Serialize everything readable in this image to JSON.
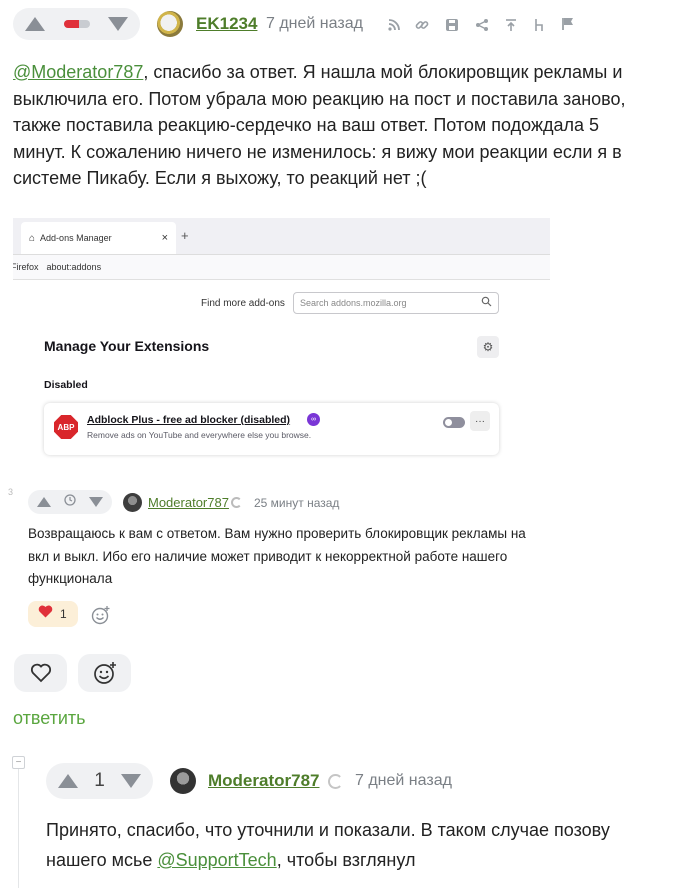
{
  "top_comment": {
    "author": "EK1234",
    "time": "7 дней назад",
    "icons": [
      "rss-icon",
      "link-icon",
      "save-icon",
      "share-icon",
      "branch-up-icon",
      "branch-icon",
      "flag-icon"
    ],
    "body_mention": "@Moderator787",
    "body_lines": [
      ", спасибо за ответ. Я нашла мой блокировщик рекламы и",
      "выключила его. Потом убрала мою реакцию на пост и поставила заново,",
      "также поставила реакцию-сердечко на ваш ответ. Потом подождала 5",
      "минут. К сожалению ничего не изменилось: я вижу мои реакции если я в",
      "системе Пикабу. Если я выхожу, то реакций нет ;("
    ],
    "screenshot": {
      "tab_title": "Add-ons Manager",
      "tab_close": "×",
      "new_tab": "+",
      "browser": "Firefox",
      "url": "about:addons",
      "find_label": "Find more add-ons",
      "search_placeholder": "Search addons.mozilla.org",
      "heading": "Manage Your Extensions",
      "section": "Disabled",
      "ext_icon_text": "ABP",
      "ext_name": "Adblock Plus - free ad blocker (disabled)",
      "ext_desc": "Remove ads on YouTube and everywhere else you browse.",
      "more": "···"
    },
    "quoted": {
      "author": "Moderator787",
      "time": "25 минут назад",
      "lines": [
        "Возвращаюсь к вам с ответом. Вам нужно проверить блокировщик рекламы на",
        "вкл и выкл. Ибо его наличие может приводит к некорректной работе нашего",
        "функционала"
      ],
      "heart_count": "1",
      "margin_digit": "3"
    },
    "reply_label": "ответить"
  },
  "reply_comment": {
    "rating": "1",
    "collapse": "−",
    "author": "Moderator787",
    "time": "7 дней назад",
    "line1": "Принято, спасибо, что уточнили и показали. В таком случае позову",
    "line2_prefix": "нашего мсье ",
    "line2_mention": "@SupportTech",
    "line2_suffix": ", чтобы взглянул"
  },
  "colors": {
    "accent_green": "#4e7d2a",
    "mention_green": "#4a8f3b",
    "rating_bg": "#f0f1f3",
    "heart_red": "#e0303a"
  }
}
